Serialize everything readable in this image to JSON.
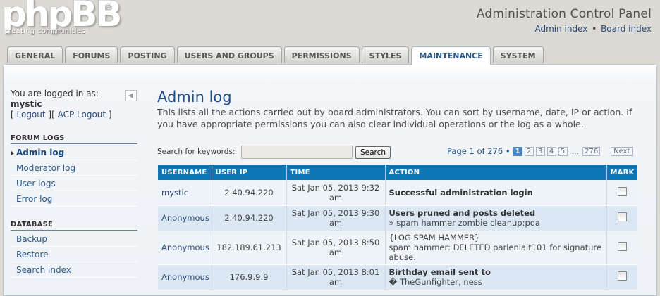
{
  "header": {
    "logo_main": "phpBB",
    "logo_reg": "®",
    "logo_sub": "creating  communities",
    "title": "Administration Control Panel",
    "links": [
      "Admin index",
      "Board index"
    ],
    "link_sep": "•"
  },
  "tabs": [
    {
      "label": "GENERAL",
      "active": false
    },
    {
      "label": "FORUMS",
      "active": false
    },
    {
      "label": "POSTING",
      "active": false
    },
    {
      "label": "USERS AND GROUPS",
      "active": false
    },
    {
      "label": "PERMISSIONS",
      "active": false
    },
    {
      "label": "STYLES",
      "active": false
    },
    {
      "label": "MAINTENANCE",
      "active": true
    },
    {
      "label": "SYSTEM",
      "active": false
    }
  ],
  "sidebar": {
    "logged_in_label": "You are logged in as:",
    "username": "mystic",
    "logout_open": "[ ",
    "logout_label": "Logout",
    "mid": " ][ ",
    "acp_logout_label": "ACP Logout",
    "close": " ]",
    "sections": [
      {
        "heading": "FORUM LOGS",
        "items": [
          {
            "label": "Admin log",
            "active": true
          },
          {
            "label": "Moderator log",
            "active": false
          },
          {
            "label": "User logs",
            "active": false
          },
          {
            "label": "Error log",
            "active": false
          }
        ]
      },
      {
        "heading": "DATABASE",
        "items": [
          {
            "label": "Backup",
            "active": false
          },
          {
            "label": "Restore",
            "active": false
          },
          {
            "label": "Search index",
            "active": false
          }
        ]
      }
    ]
  },
  "main": {
    "title": "Admin log",
    "description": "This lists all the actions carried out by board administrators. You can sort by username, date, IP or action. If you have appropriate permissions you can also clear individual operations or the log as a whole.",
    "search_label": "Search for keywords:",
    "search_value": "",
    "search_button": "Search",
    "pagination": {
      "text": "Page 1 of 276 •",
      "pages": [
        "1",
        "2",
        "3",
        "4",
        "5"
      ],
      "current": "1",
      "ellipsis": "...",
      "last": "276",
      "next": "Next"
    },
    "table": {
      "headers": [
        "USERNAME",
        "USER IP",
        "TIME",
        "ACTION",
        "MARK"
      ],
      "rows": [
        {
          "user": "mystic",
          "ip": "2.40.94.220",
          "time": "Sat Jan 05, 2013 9:32 am",
          "action_title": "Successful administration login",
          "action_sub": ""
        },
        {
          "user": "Anonymous",
          "ip": "2.40.94.220",
          "time": "Sat Jan 05, 2013 9:30 am",
          "action_title": "Users pruned and posts deleted",
          "action_sub": "» spam hammer zombie cleanup:poa"
        },
        {
          "user": "Anonymous",
          "ip": "182.189.61.213",
          "time": "Sat Jan 05, 2013 8:50 am",
          "action_title": "",
          "action_sub": "{LOG SPAM HAMMER}\nspam hammer: DELETED parlenlait101 for signature abuse."
        },
        {
          "user": "Anonymous",
          "ip": "176.9.9.9",
          "time": "Sat Jan 05, 2013 8:01 am",
          "action_title": "Birthday email sent to",
          "action_sub": "� TheGunfighter, ness"
        }
      ]
    }
  }
}
